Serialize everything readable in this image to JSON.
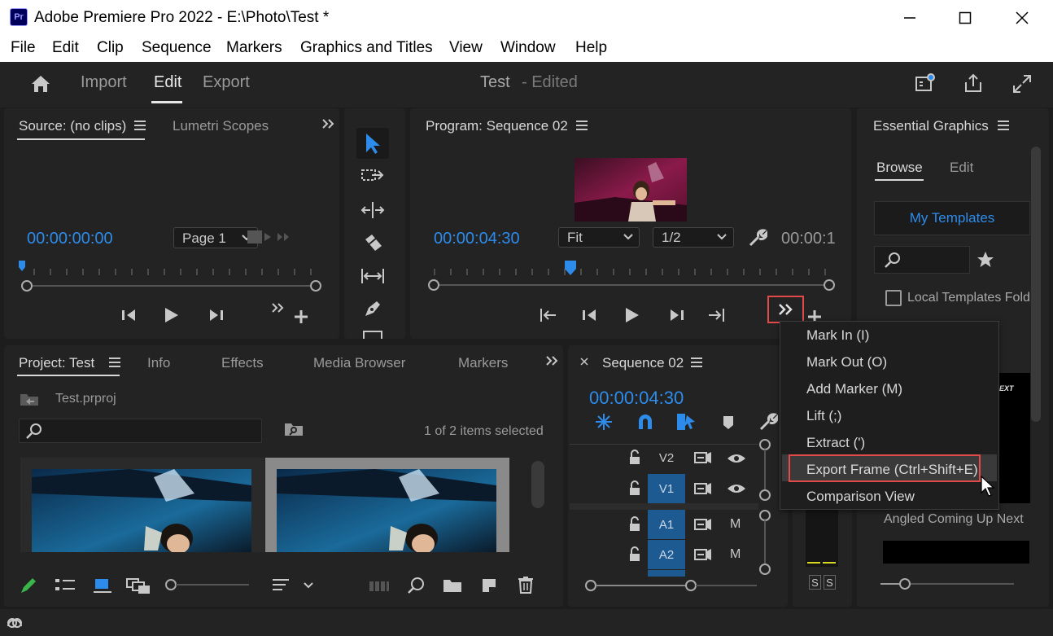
{
  "window": {
    "app_icon": "Pr",
    "title": "Adobe Premiere Pro 2022 - E:\\Photo\\Test *"
  },
  "menu": [
    "File",
    "Edit",
    "Clip",
    "Sequence",
    "Markers",
    "Graphics and Titles",
    "View",
    "Window",
    "Help"
  ],
  "header": {
    "tabs": [
      "Import",
      "Edit",
      "Export"
    ],
    "active_tab": "Edit",
    "project_title": "Test",
    "project_status": "- Edited"
  },
  "source_panel": {
    "tab_source": "Source: (no clips)",
    "tab_lumetri": "Lumetri Scopes",
    "timecode": "00:00:00:00",
    "page_select": "Page 1"
  },
  "program_panel": {
    "tab": "Program: Sequence 02",
    "timecode": "00:00:04:30",
    "fit_select": "Fit",
    "resolution_select": "1/2",
    "duration": "00:00:1"
  },
  "essential_graphics": {
    "tab": "Essential Graphics",
    "subtabs": [
      "Browse",
      "Edit"
    ],
    "my_templates": "My Templates",
    "local_templates": "Local Templates Folder",
    "template_thumb_text": "EXT",
    "template_name": "Angled Coming Up Next"
  },
  "project_panel": {
    "tabs": [
      "Project: Test",
      "Info",
      "Effects",
      "Media Browser",
      "Markers"
    ],
    "file_name": "Test.prproj",
    "selection_status": "1 of 2 items selected",
    "thumbnail_count": 2
  },
  "timeline": {
    "tab": "Sequence 02",
    "timecode": "00:00:04:30",
    "tracks": [
      {
        "name": "V2",
        "type": "video"
      },
      {
        "name": "V1",
        "type": "video"
      },
      {
        "name": "A1",
        "type": "audio",
        "m": "M"
      },
      {
        "name": "A2",
        "type": "audio",
        "m": "M"
      }
    ]
  },
  "audio_meter": {
    "solo_labels": [
      "S",
      "S"
    ]
  },
  "context_menu": {
    "items": [
      "Mark In (I)",
      "Mark Out (O)",
      "Add Marker (M)",
      "Lift (;)",
      "Extract (')",
      "Export Frame (Ctrl+Shift+E)",
      "Comparison View"
    ],
    "highlighted": "Export Frame (Ctrl+Shift+E)"
  },
  "colors": {
    "accent_blue": "#2d8ceb",
    "highlight_red": "#e24a4a",
    "panel_bg": "#232323",
    "track_blue": "#1e5a92"
  }
}
